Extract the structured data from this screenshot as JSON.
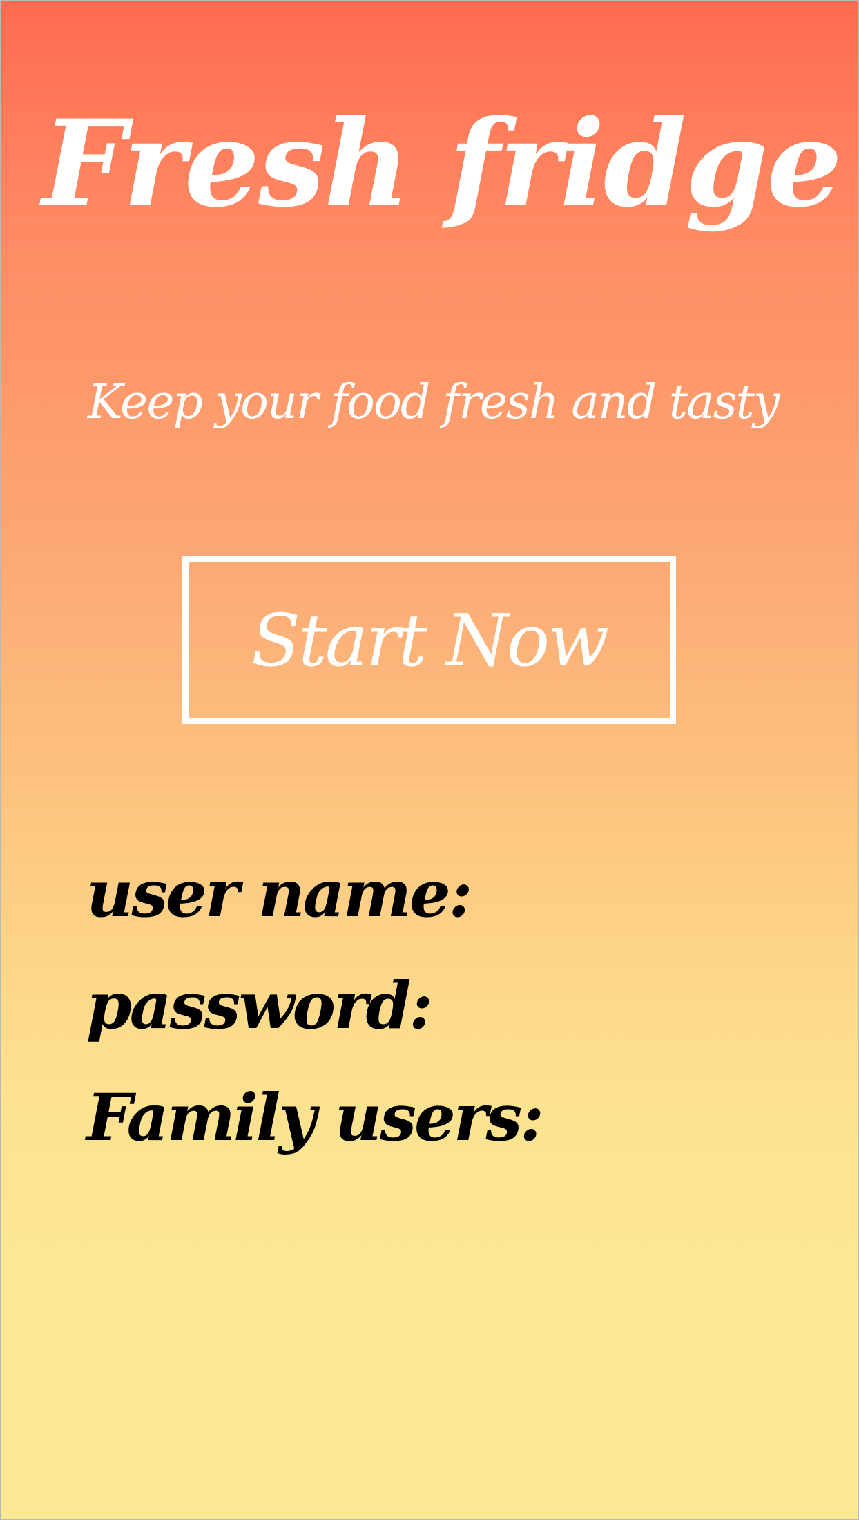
{
  "app": {
    "title": "Fresh fridge",
    "tagline": "Keep your food fresh and tasty"
  },
  "actions": {
    "start_label": "Start Now"
  },
  "form": {
    "username_label": "user name:",
    "password_label": "password:",
    "family_label": "Family users:"
  },
  "colors": {
    "gradient_top": "#ff6b50",
    "gradient_bottom": "#fbe995",
    "heading_text": "#ffffff",
    "form_text": "#000000"
  }
}
